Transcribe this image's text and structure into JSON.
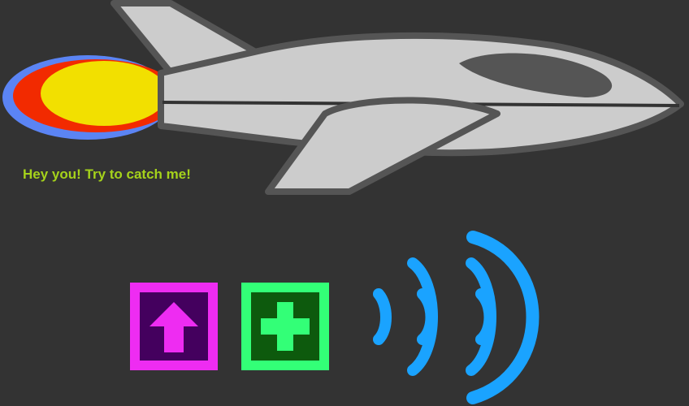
{
  "scene": {
    "background_color": "#333333",
    "taunt_text": "Hey you! Try to catch me!",
    "taunt_color": "#a5d21b"
  },
  "jet": {
    "body_color": "#cccccc",
    "outline_color": "#555555",
    "canopy_color": "#555555",
    "flame_outer_color": "#5b84f4",
    "flame_middle_color": "#f22a00",
    "flame_inner_color": "#f2e000"
  },
  "powerups": [
    {
      "name": "arrow-up",
      "frame_color": "#ee2cf2",
      "fill_color": "#44005e",
      "symbol_color": "#ee2cf2"
    },
    {
      "name": "plus",
      "frame_color": "#33ff77",
      "fill_color": "#0d5a0d",
      "symbol_color": "#33ff77"
    }
  ],
  "signal": {
    "color": "#1aa3ff"
  }
}
